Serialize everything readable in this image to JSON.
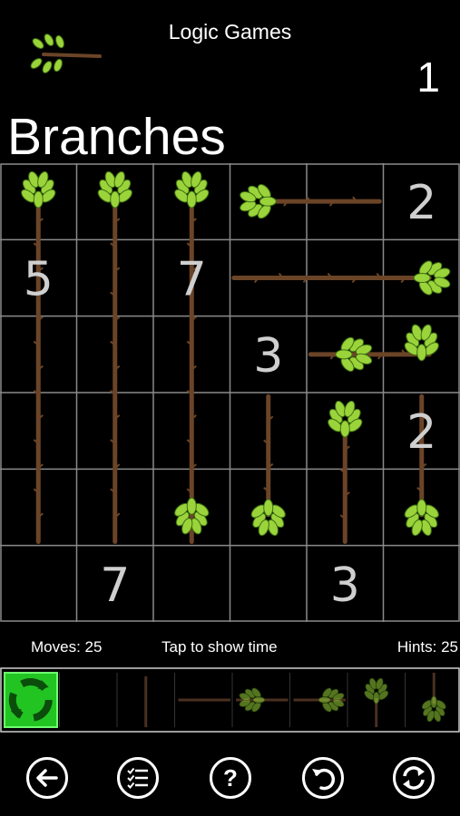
{
  "header": {
    "app_title": "Logic Games",
    "level": "1"
  },
  "page_title": "Branches",
  "board": {
    "rows": 6,
    "cols": 6,
    "numbers": [
      {
        "r": 0,
        "c": 5,
        "v": "2"
      },
      {
        "r": 1,
        "c": 0,
        "v": "5"
      },
      {
        "r": 1,
        "c": 2,
        "v": "7"
      },
      {
        "r": 2,
        "c": 3,
        "v": "3"
      },
      {
        "r": 3,
        "c": 5,
        "v": "2"
      },
      {
        "r": 5,
        "c": 1,
        "v": "7"
      },
      {
        "r": 5,
        "c": 4,
        "v": "3"
      }
    ],
    "branches": [
      {
        "from": [
          0,
          0
        ],
        "to": [
          4,
          0
        ],
        "leaf": "top"
      },
      {
        "from": [
          0,
          1
        ],
        "to": [
          4,
          1
        ],
        "leaf": "top"
      },
      {
        "from": [
          0,
          2
        ],
        "to": [
          4,
          2
        ],
        "leaf": "top-bottom"
      },
      {
        "from": [
          0,
          3
        ],
        "to": [
          0,
          4
        ],
        "leaf": "left"
      },
      {
        "from": [
          1,
          3
        ],
        "to": [
          1,
          5
        ],
        "leaf": "right"
      },
      {
        "from": [
          2,
          4
        ],
        "to": [
          2,
          5
        ],
        "leaf": "right-top"
      },
      {
        "from": [
          3,
          3
        ],
        "to": [
          4,
          3
        ],
        "leaf": "bottom"
      },
      {
        "from": [
          3,
          4
        ],
        "to": [
          4,
          4
        ],
        "leaf": "top"
      },
      {
        "from": [
          3,
          5
        ],
        "to": [
          4,
          5
        ],
        "leaf": "bottom"
      }
    ]
  },
  "stats": {
    "moves": "Moves: 25",
    "timer": "Tap to show time",
    "hints": "Hints: 25"
  },
  "tray": {
    "selected_color": "#22c422",
    "items": [
      "rotate-selector",
      "empty",
      "vertical-stem",
      "horizontal-stem",
      "horizontal-leaf-pair",
      "horizontal-leaf",
      "vertical-leaf",
      "vertical-leaf-bottom"
    ]
  },
  "toolbar": {
    "buttons": [
      "back-icon",
      "menu-list-icon",
      "help-icon",
      "undo-icon",
      "refresh-icon"
    ]
  }
}
